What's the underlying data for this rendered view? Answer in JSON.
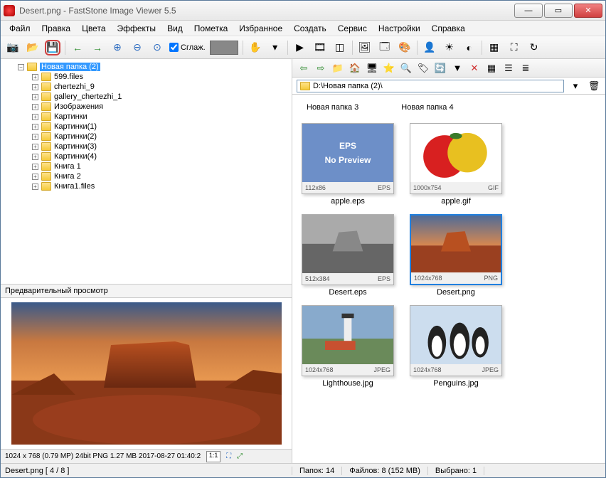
{
  "title": "Desert.png   -   FastStone Image Viewer 5.5",
  "menu": [
    "Файл",
    "Правка",
    "Цвета",
    "Эффекты",
    "Вид",
    "Пометка",
    "Избранное",
    "Создать",
    "Сервис",
    "Настройки",
    "Справка"
  ],
  "toolbar": {
    "smooth": "Сглаж."
  },
  "tree": {
    "root": "Новая папка (2)",
    "items": [
      "599.files",
      "chertezhi_9",
      "gallery_chertezhi_1",
      "Изображения",
      "Картинки",
      "Картинки(1)",
      "Картинки(2)",
      "Картинки(3)",
      "Картинки(4)",
      "Книга 1",
      "Книга 2",
      "Книга1.files"
    ]
  },
  "preview": {
    "title": "Предварительный просмотр",
    "info": "1024 x 768 (0.79 MP)  24bit  PNG   1.27 MB   2017-08-27 01:40:2",
    "ratio": "1:1"
  },
  "path": "D:\\Новая папка (2)\\",
  "folders_row": [
    "Новая папка 3",
    "Новая папка 4"
  ],
  "thumbs": [
    {
      "dim": "112x86",
      "fmt": "EPS",
      "name": "apple.eps",
      "type": "eps"
    },
    {
      "dim": "1000x754",
      "fmt": "GIF",
      "name": "apple.gif",
      "type": "apple"
    },
    {
      "dim": "512x384",
      "fmt": "EPS",
      "name": "Desert.eps",
      "type": "desert-bw"
    },
    {
      "dim": "1024x768",
      "fmt": "PNG",
      "name": "Desert.png",
      "type": "desert",
      "selected": true
    },
    {
      "dim": "1024x768",
      "fmt": "JPEG",
      "name": "Lighthouse.jpg",
      "type": "lighthouse"
    },
    {
      "dim": "1024x768",
      "fmt": "JPEG",
      "name": "Penguins.jpg",
      "type": "penguins"
    }
  ],
  "eps": {
    "line1": "EPS",
    "line2": "No Preview"
  },
  "status": {
    "left": "Desert.png [ 4 / 8 ]",
    "folders": "Папок: 14",
    "files": "Файлов: 8 (152 MB)",
    "selected": "Выбрано: 1"
  }
}
